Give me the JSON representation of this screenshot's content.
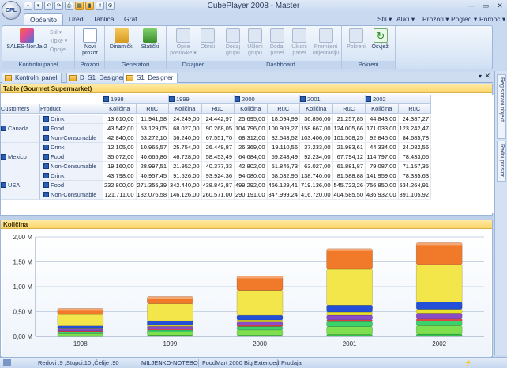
{
  "window": {
    "title": "CubePlayer 2008 - Master",
    "app_logo": "CPL"
  },
  "ribbon_tabs": [
    "Općenito",
    "Uredi",
    "Tablica",
    "Graf"
  ],
  "right_menus": [
    "Stil ▾",
    "Alati ▾",
    "Prozori ▾",
    "Pogled ▾",
    "Pomoć ▾"
  ],
  "ribbon": {
    "groups": [
      {
        "label": "Kontrolni panel",
        "buttons": [
          "SALES-NonJa-2",
          "Stil ▾",
          "Tipke ▾",
          "Opcije"
        ]
      },
      {
        "label": "Prozori",
        "buttons": [
          "Novi prozor"
        ]
      },
      {
        "label": "Generatori",
        "buttons": [
          "Dinamički",
          "Statički"
        ]
      },
      {
        "label": "Dizajner",
        "buttons": [
          "Opće postavke ▾",
          "Obriši"
        ]
      },
      {
        "label": "Dashboard",
        "buttons": [
          "Dodaj grupu",
          "Ukloni grupu",
          "Dodaj panel",
          "Ukloni panel",
          "Promijeni orijentaciju"
        ]
      },
      {
        "label": "Pokreni",
        "buttons": [
          "Pokreni",
          "Osvježi"
        ]
      }
    ]
  },
  "doc_tabs": [
    "Kontrolni panel",
    "D_S1_Designer",
    "S1_Designer"
  ],
  "side_tabs": [
    "Registrirani objekt",
    "Radni prostor"
  ],
  "table": {
    "title": "Table (Gourmet Supermarket)",
    "row_headers": [
      "Customers",
      "Product"
    ],
    "years": [
      "1998",
      "1999",
      "2000",
      "2001",
      "2002"
    ],
    "measures": [
      "Količina",
      "RuC"
    ],
    "countries": [
      "Canada",
      "Mexico",
      "USA"
    ],
    "products": [
      "Drink",
      "Food",
      "Non-Consumable"
    ],
    "rows": [
      [
        "13.610,00",
        "11.941,58",
        "24.249,00",
        "24.442,97",
        "25.695,00",
        "18.094,99",
        "36.856,00",
        "21.257,85",
        "44.843,00",
        "24.387,27"
      ],
      [
        "43.542,00",
        "53.129,05",
        "68.027,00",
        "90.268,05",
        "104.796,00",
        "100.909,27",
        "158.667,00",
        "124.005,66",
        "171.033,00",
        "123.242,47"
      ],
      [
        "42.840,00",
        "63.272,10",
        "36.240,00",
        "67.551,70",
        "68.312,00",
        "82.543,52",
        "103.406,00",
        "101.508,25",
        "92.845,00",
        "84.685,78"
      ],
      [
        "12.105,00",
        "10.965,57",
        "25.754,00",
        "26.449,87",
        "26.369,00",
        "19.110,56",
        "37.233,00",
        "21.983,61",
        "44.334,00",
        "24.082,56"
      ],
      [
        "35.072,00",
        "40.665,86",
        "46.728,00",
        "58.453,49",
        "64.684,00",
        "59.248,49",
        "92.234,00",
        "67.794,12",
        "114.797,00",
        "78.433,06"
      ],
      [
        "19.160,00",
        "28.997,51",
        "21.952,00",
        "40.377,33",
        "42.802,00",
        "51.845,73",
        "63.027,00",
        "61.881,87",
        "79.087,00",
        "71.157,35"
      ],
      [
        "43.798,00",
        "40.957,45",
        "91.526,00",
        "93.924,36",
        "94.080,00",
        "68.032,95",
        "138.740,00",
        "81.588,88",
        "141.959,00",
        "78.335,63"
      ],
      [
        "232.800,00",
        "271.355,39",
        "342.440,00",
        "438.843,87",
        "499.292,00",
        "466.129,41",
        "719.136,00",
        "545.722,26",
        "756.850,00",
        "534.264,91"
      ],
      [
        "121.711,00",
        "182.076,58",
        "146.126,00",
        "260.571,00",
        "290.191,00",
        "347.999,24",
        "416.720,00",
        "404.585,50",
        "436.932,00",
        "391.105,92"
      ]
    ]
  },
  "chart_panel_title": "Količina",
  "chart_data": {
    "type": "bar",
    "stacked": true,
    "categories": [
      "1998",
      "1999",
      "2000",
      "2001",
      "2002"
    ],
    "y_tick_labels": [
      "0,00 M",
      "0,50 M",
      "1,00 M",
      "1,50 M",
      "2,00 M"
    ],
    "ylim": [
      0,
      2000000
    ],
    "series": [
      {
        "values": [
          13610,
          24249,
          25695,
          36856,
          44843
        ],
        "color": "#2fc24a"
      },
      {
        "values": [
          43542,
          68027,
          104796,
          158667,
          171033
        ],
        "color": "#7ee04f"
      },
      {
        "values": [
          42840,
          36240,
          68312,
          103406,
          92845
        ],
        "color": "#3bd16b"
      },
      {
        "values": [
          12105,
          25754,
          26369,
          37233,
          44334
        ],
        "color": "#e04545"
      },
      {
        "values": [
          35072,
          46728,
          64684,
          92234,
          114797
        ],
        "color": "#8a4cc9"
      },
      {
        "values": [
          19160,
          21952,
          42802,
          63027,
          79087
        ],
        "color": "#e9e32b"
      },
      {
        "values": [
          43798,
          91526,
          94080,
          138740,
          141959
        ],
        "color": "#2450d8"
      },
      {
        "values": [
          232800,
          342440,
          499292,
          719136,
          756850
        ],
        "color": "#f2e64a"
      },
      {
        "values": [
          121711,
          146126,
          290191,
          416720,
          436932
        ],
        "color": "#f07a2a"
      }
    ],
    "grid": true
  },
  "status": {
    "position": "Redovi :9 ,Stupci:10 ,Ćelije :90",
    "host": "MILJENKO-NOTEBO",
    "database": "FoodMart 2000 Big Extended",
    "cube": "Prodaja"
  }
}
